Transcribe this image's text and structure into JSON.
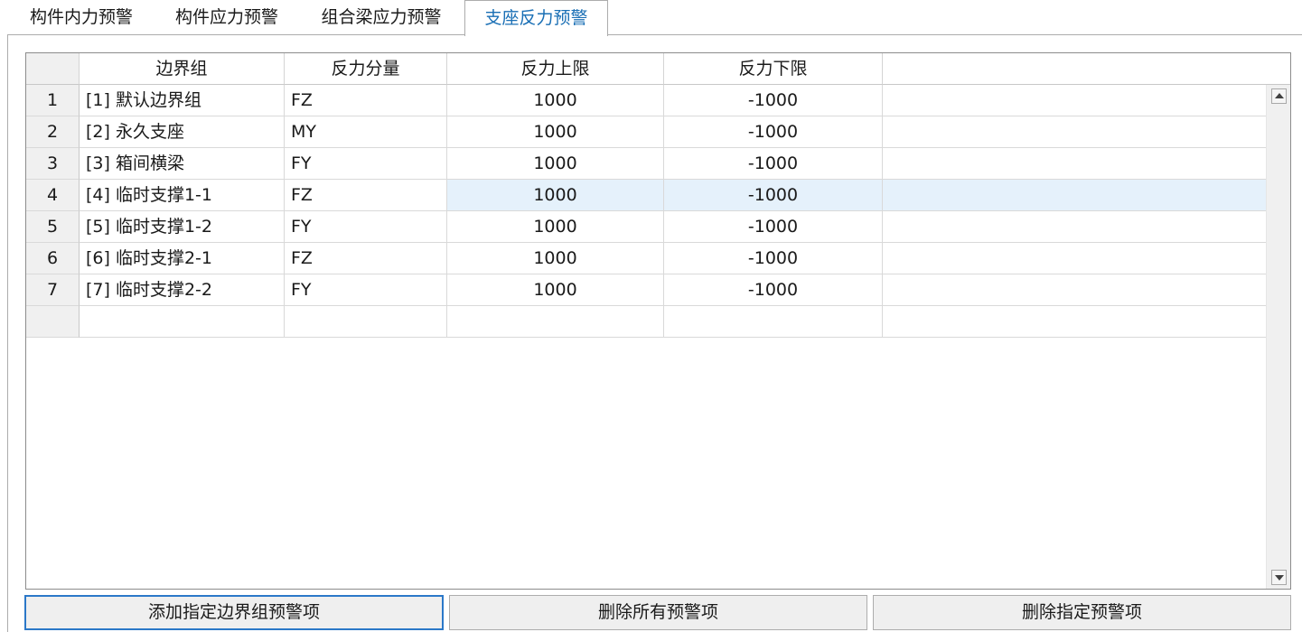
{
  "tabs": [
    {
      "label": "构件内力预警",
      "active": false
    },
    {
      "label": "构件应力预警",
      "active": false
    },
    {
      "label": "组合梁应力预警",
      "active": false
    },
    {
      "label": "支座反力预警",
      "active": true
    }
  ],
  "grid": {
    "columns": [
      "边界组",
      "反力分量",
      "反力上限",
      "反力下限"
    ],
    "rows": [
      {
        "num": "1",
        "group": "[1] 默认边界组",
        "component": "FZ",
        "upper": "1000",
        "lower": "-1000",
        "selected": false
      },
      {
        "num": "2",
        "group": "[2] 永久支座",
        "component": "MY",
        "upper": "1000",
        "lower": "-1000",
        "selected": false
      },
      {
        "num": "3",
        "group": "[3] 箱间横梁",
        "component": "FY",
        "upper": "1000",
        "lower": "-1000",
        "selected": false
      },
      {
        "num": "4",
        "group": "[4] 临时支撑1-1",
        "component": "FZ",
        "upper": "1000",
        "lower": "-1000",
        "selected": true
      },
      {
        "num": "5",
        "group": "[5] 临时支撑1-2",
        "component": "FY",
        "upper": "1000",
        "lower": "-1000",
        "selected": false
      },
      {
        "num": "6",
        "group": "[6] 临时支撑2-1",
        "component": "FZ",
        "upper": "1000",
        "lower": "-1000",
        "selected": false
      },
      {
        "num": "7",
        "group": "[7] 临时支撑2-2",
        "component": "FY",
        "upper": "1000",
        "lower": "-1000",
        "selected": false
      }
    ]
  },
  "scrollbar": {
    "up_icon": "scroll-up-arrow-icon",
    "down_icon": "scroll-down-arrow-icon"
  },
  "buttons": {
    "add": "添加指定边界组预警项",
    "delete_all": "删除所有预警项",
    "delete_selected": "删除指定预警项"
  },
  "colors": {
    "active_tab_text": "#1a6fb5",
    "selected_row": "#e5f1fb",
    "focus_border": "#2b78c8",
    "header_bg": "#f0f0f0"
  }
}
